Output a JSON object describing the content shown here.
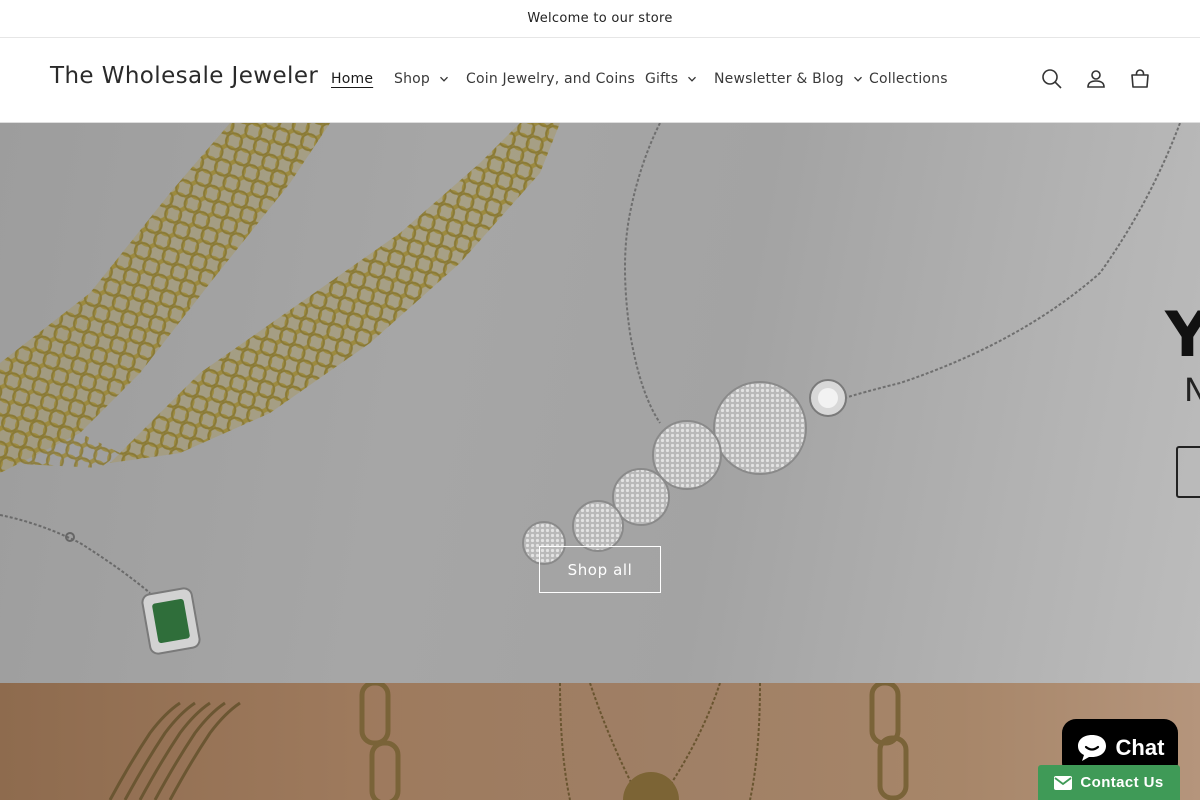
{
  "announcement": {
    "text": "Welcome to our store"
  },
  "header": {
    "logo": "The Wholesale Jeweler",
    "nav": [
      {
        "label": "Home",
        "active": true,
        "dropdown": false
      },
      {
        "label": "Shop",
        "active": false,
        "dropdown": true
      },
      {
        "label": "Coin Jewelry, and Coins",
        "active": false,
        "dropdown": false
      },
      {
        "label": "Gifts",
        "active": false,
        "dropdown": true
      },
      {
        "label": "Newsletter & Blog",
        "active": false,
        "dropdown": true
      },
      {
        "label": "Collections",
        "active": false,
        "dropdown": false
      }
    ],
    "icons": [
      "search-icon",
      "account-icon",
      "cart-icon"
    ]
  },
  "hero": {
    "button_label": "Shop all",
    "partial_heading": "Y",
    "partial_subheading": "N"
  },
  "chat": {
    "chat_label": "Chat",
    "contact_label": "Contact Us",
    "chat_color": "#000000",
    "contact_color": "#3f9a57"
  }
}
